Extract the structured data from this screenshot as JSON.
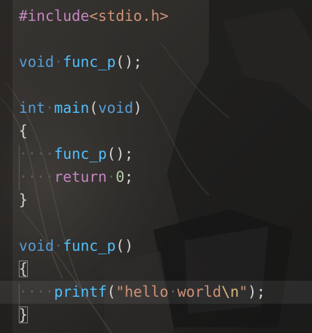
{
  "editor": {
    "lines": [
      {
        "tokens": [
          {
            "t": "#include",
            "c": "pp"
          },
          {
            "t": "<stdio.h>",
            "c": "inc"
          }
        ]
      },
      {
        "tokens": []
      },
      {
        "tokens": [
          {
            "t": "void",
            "c": "kw"
          },
          {
            "t": "·",
            "c": "ws"
          },
          {
            "t": "func_p",
            "c": "fn"
          },
          {
            "t": "();",
            "c": "punc"
          }
        ]
      },
      {
        "tokens": []
      },
      {
        "tokens": [
          {
            "t": "int",
            "c": "kw"
          },
          {
            "t": "·",
            "c": "ws"
          },
          {
            "t": "main",
            "c": "fn"
          },
          {
            "t": "(",
            "c": "punc"
          },
          {
            "t": "void",
            "c": "kw"
          },
          {
            "t": ")",
            "c": "punc"
          }
        ]
      },
      {
        "tokens": [
          {
            "t": "{",
            "c": "punc"
          }
        ]
      },
      {
        "tokens": [
          {
            "t": "····",
            "c": "ws"
          },
          {
            "t": "func_p",
            "c": "fn"
          },
          {
            "t": "();",
            "c": "punc"
          }
        ]
      },
      {
        "tokens": [
          {
            "t": "····",
            "c": "ws"
          },
          {
            "t": "return",
            "c": "pp"
          },
          {
            "t": "·",
            "c": "ws"
          },
          {
            "t": "0",
            "c": "num"
          },
          {
            "t": ";",
            "c": "punc"
          }
        ]
      },
      {
        "tokens": [
          {
            "t": "}",
            "c": "punc"
          }
        ]
      },
      {
        "tokens": []
      },
      {
        "tokens": [
          {
            "t": "void",
            "c": "kw"
          },
          {
            "t": "·",
            "c": "ws"
          },
          {
            "t": "func_p",
            "c": "fn"
          },
          {
            "t": "()",
            "c": "punc"
          }
        ]
      },
      {
        "tokens": [
          {
            "t": "{",
            "c": "punc brace-box"
          }
        ]
      },
      {
        "tokens": [
          {
            "t": "····",
            "c": "ws"
          },
          {
            "t": "printf",
            "c": "fn"
          },
          {
            "t": "(",
            "c": "punc"
          },
          {
            "t": "\"hello",
            "c": "str"
          },
          {
            "t": "·",
            "c": "ws"
          },
          {
            "t": "world",
            "c": "str"
          },
          {
            "t": "\\n",
            "c": "esc"
          },
          {
            "t": "\"",
            "c": "str"
          },
          {
            "t": ");",
            "c": "punc"
          }
        ]
      },
      {
        "tokens": [
          {
            "t": "}",
            "c": "punc brace-box"
          }
        ]
      }
    ],
    "current_line": 12
  }
}
